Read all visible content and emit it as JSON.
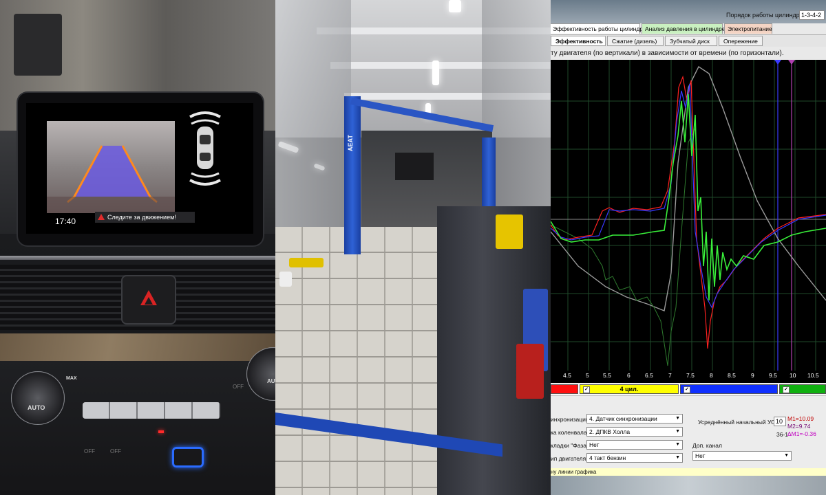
{
  "car_screen": {
    "time": "17:40",
    "warning": "Следите за движением!"
  },
  "car_controls": {
    "max_label": "MAX",
    "auto_label": "AUTO",
    "auto_label_right": "AUT",
    "off1": "OFF",
    "off2": "OFF",
    "off3": "OFF"
  },
  "lift_brand": "AEAT",
  "osc": {
    "order_label": "Порядок работы цилиндров",
    "order_value": "1-3-4-2",
    "tabs": [
      "Эффективность работы цилиндров",
      "Анализ давления в цилиндре",
      "Электропитание"
    ],
    "subtabs": [
      "Эффективность",
      "Сжатие (дизель)",
      "Зубчатый диск",
      "Опережение"
    ],
    "description": "ту двигателя (по вертикали) в зависимости от времени (по горизонтали).",
    "x_ticks": [
      "4.5",
      "5",
      "5.5",
      "6",
      "6.5",
      "7",
      "7.5",
      "8",
      "8.5",
      "9",
      "9.5",
      "10",
      "10.5"
    ],
    "cyl_bar": [
      "",
      "4 цил.",
      "",
      ""
    ],
    "form": {
      "sync_label": "инхронизации",
      "sync_value": "4.  Датчик синхронизации",
      "crank_label": "ка коленвала",
      "crank_value": "2.  ДПКВ Холла",
      "phase_label": "кладки \"Фаза\"",
      "phase_value": "Нет",
      "engine_label": "ип двигателя",
      "engine_value": "4 такт бензин",
      "uoz_label": "Усреднённый начальный УОЗ",
      "uoz_value": "10",
      "teeth": "36-1",
      "extra_label": "Доп. канал",
      "extra_value": "Нет",
      "m1": "M1=10.09",
      "m2": "M2=9.74",
      "dm": "ΔM1=-0.36"
    },
    "hint": "ну линии графика"
  },
  "colors": {
    "green_trace": "#39f03a",
    "red_trace": "#ff2020",
    "blue_trace": "#3838ff",
    "grey_trace": "#9a9a9a",
    "cyl_red": "#ff1010",
    "cyl_yellow": "#ffff00",
    "cyl_blue": "#1030ff",
    "cyl_green": "#10b010"
  }
}
